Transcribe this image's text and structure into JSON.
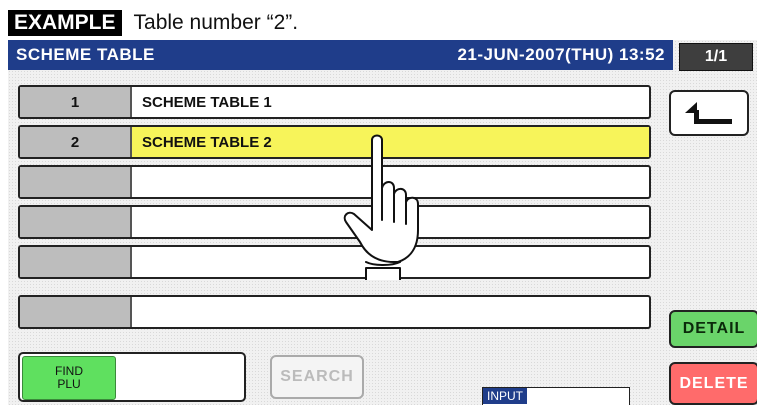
{
  "example": {
    "tag": "EXAMPLE",
    "caption": "Table number “2”."
  },
  "header": {
    "title": "SCHEME TABLE",
    "datetime": "21-JUN-2007(THU) 13:52",
    "page": "1/1"
  },
  "rows": [
    {
      "number": "1",
      "name": "SCHEME TABLE 1"
    },
    {
      "number": "2",
      "name": "SCHEME TABLE 2"
    },
    {
      "number": "",
      "name": ""
    },
    {
      "number": "",
      "name": ""
    },
    {
      "number": "",
      "name": ""
    },
    {
      "number": "",
      "name": ""
    }
  ],
  "buttons": {
    "find_plu_line1": "FIND",
    "find_plu_line2": "PLU",
    "search": "SEARCH",
    "detail": "DETAIL",
    "delete": "DELETE",
    "input_label": "INPUT"
  },
  "icons": {
    "back": "back-arrow-icon",
    "pointer": "pointing-hand-icon"
  },
  "colors": {
    "header": "#1f3d8a",
    "selected_row": "#f7f45a",
    "detail": "#6ad46a",
    "delete": "#ff6b6b",
    "find": "#5fe05f"
  }
}
